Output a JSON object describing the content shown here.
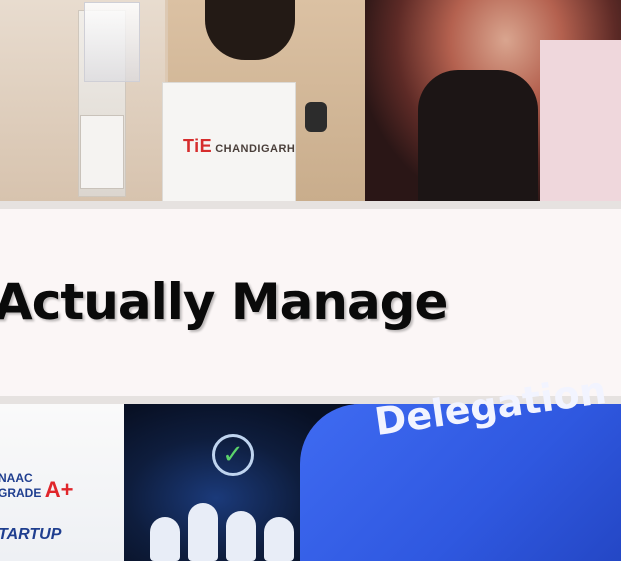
{
  "top_photo": {
    "bag_logo_mark": "TiE",
    "bag_logo_text": "CHANDIGARH"
  },
  "banner": {
    "headline": "Actually Manage"
  },
  "bottom_photo": {
    "naac_line1": "NAAC",
    "naac_line2": "GRADE",
    "naac_grade": "A+",
    "startup_text": "TARTUP",
    "screen_text": "Delegation"
  }
}
